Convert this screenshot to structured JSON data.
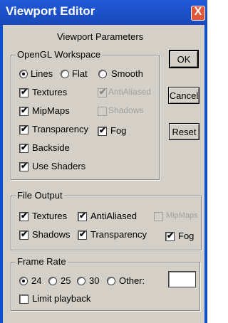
{
  "window": {
    "title": "Viewport Editor",
    "close_glyph": "X"
  },
  "heading": "Viewport Parameters",
  "opengl": {
    "legend": "OpenGL Workspace",
    "shading": [
      {
        "label": "Lines",
        "selected": true
      },
      {
        "label": "Flat",
        "selected": false
      },
      {
        "label": "Smooth",
        "selected": false
      }
    ],
    "options": {
      "textures": {
        "label": "Textures",
        "checked": true
      },
      "antialiased": {
        "label": "AntiAliased",
        "checked": true,
        "disabled": true
      },
      "mipmaps": {
        "label": "MipMaps",
        "checked": true
      },
      "shadows": {
        "label": "Shadows",
        "checked": false,
        "disabled": true
      },
      "transparency": {
        "label": "Transparency",
        "checked": true
      },
      "fog": {
        "label": "Fog",
        "checked": true
      },
      "backside": {
        "label": "Backside",
        "checked": true
      },
      "use_shaders": {
        "label": "Use Shaders",
        "checked": true
      }
    }
  },
  "buttons": {
    "ok": "OK",
    "cancel": "Cancel",
    "reset": "Reset"
  },
  "file_output": {
    "legend": "File Output",
    "options": {
      "textures": {
        "label": "Textures",
        "checked": true
      },
      "antialiased": {
        "label": "AntiAliased",
        "checked": true
      },
      "mipmaps": {
        "label": "MipMaps",
        "checked": false,
        "disabled": true
      },
      "shadows": {
        "label": "Shadows",
        "checked": true
      },
      "transparency": {
        "label": "Transparency",
        "checked": true
      },
      "fog": {
        "label": "Fog",
        "checked": true
      }
    }
  },
  "frame_rate": {
    "legend": "Frame Rate",
    "rates": [
      {
        "label": "24",
        "selected": true
      },
      {
        "label": "25",
        "selected": false
      },
      {
        "label": "30",
        "selected": false
      },
      {
        "label": "Other:",
        "selected": false
      }
    ],
    "other_value": "",
    "limit_playback": {
      "label": "Limit playback",
      "checked": false
    }
  },
  "check_glyph": "✔",
  "colors": {
    "title_bar": "#1a4fc4",
    "dialog_bg": "#d4d0c8",
    "close_button": "#e0573a"
  }
}
